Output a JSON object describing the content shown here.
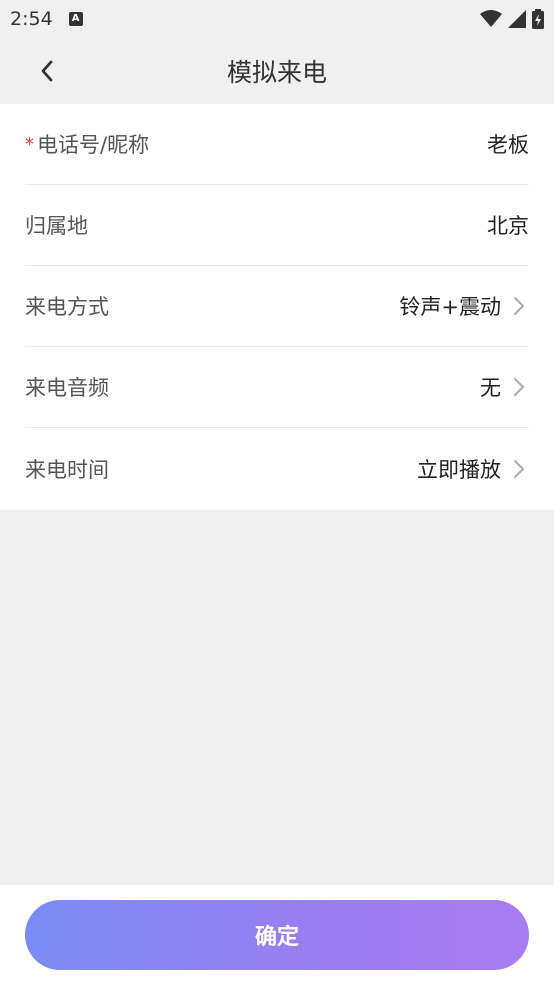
{
  "status_bar": {
    "time": "2:54",
    "notification_icon_letter": "A"
  },
  "header": {
    "title": "模拟来电",
    "back_icon": "chevron-left-icon"
  },
  "form": {
    "rows": [
      {
        "label": "电话号/昵称",
        "required_mark": "*",
        "value": "老板",
        "has_chevron": false
      },
      {
        "label": "归属地",
        "value": "北京",
        "has_chevron": false
      },
      {
        "label": "来电方式",
        "value": "铃声+震动",
        "has_chevron": true
      },
      {
        "label": "来电音频",
        "value": "无",
        "has_chevron": true
      },
      {
        "label": "来电时间",
        "value": "立即播放",
        "has_chevron": true
      }
    ]
  },
  "footer": {
    "confirm_label": "确定"
  },
  "colors": {
    "background": "#f0f0f0",
    "card": "#ffffff",
    "required": "#e53935",
    "button_gradient_start": "#7b8cf5",
    "button_gradient_end": "#a97df0"
  }
}
